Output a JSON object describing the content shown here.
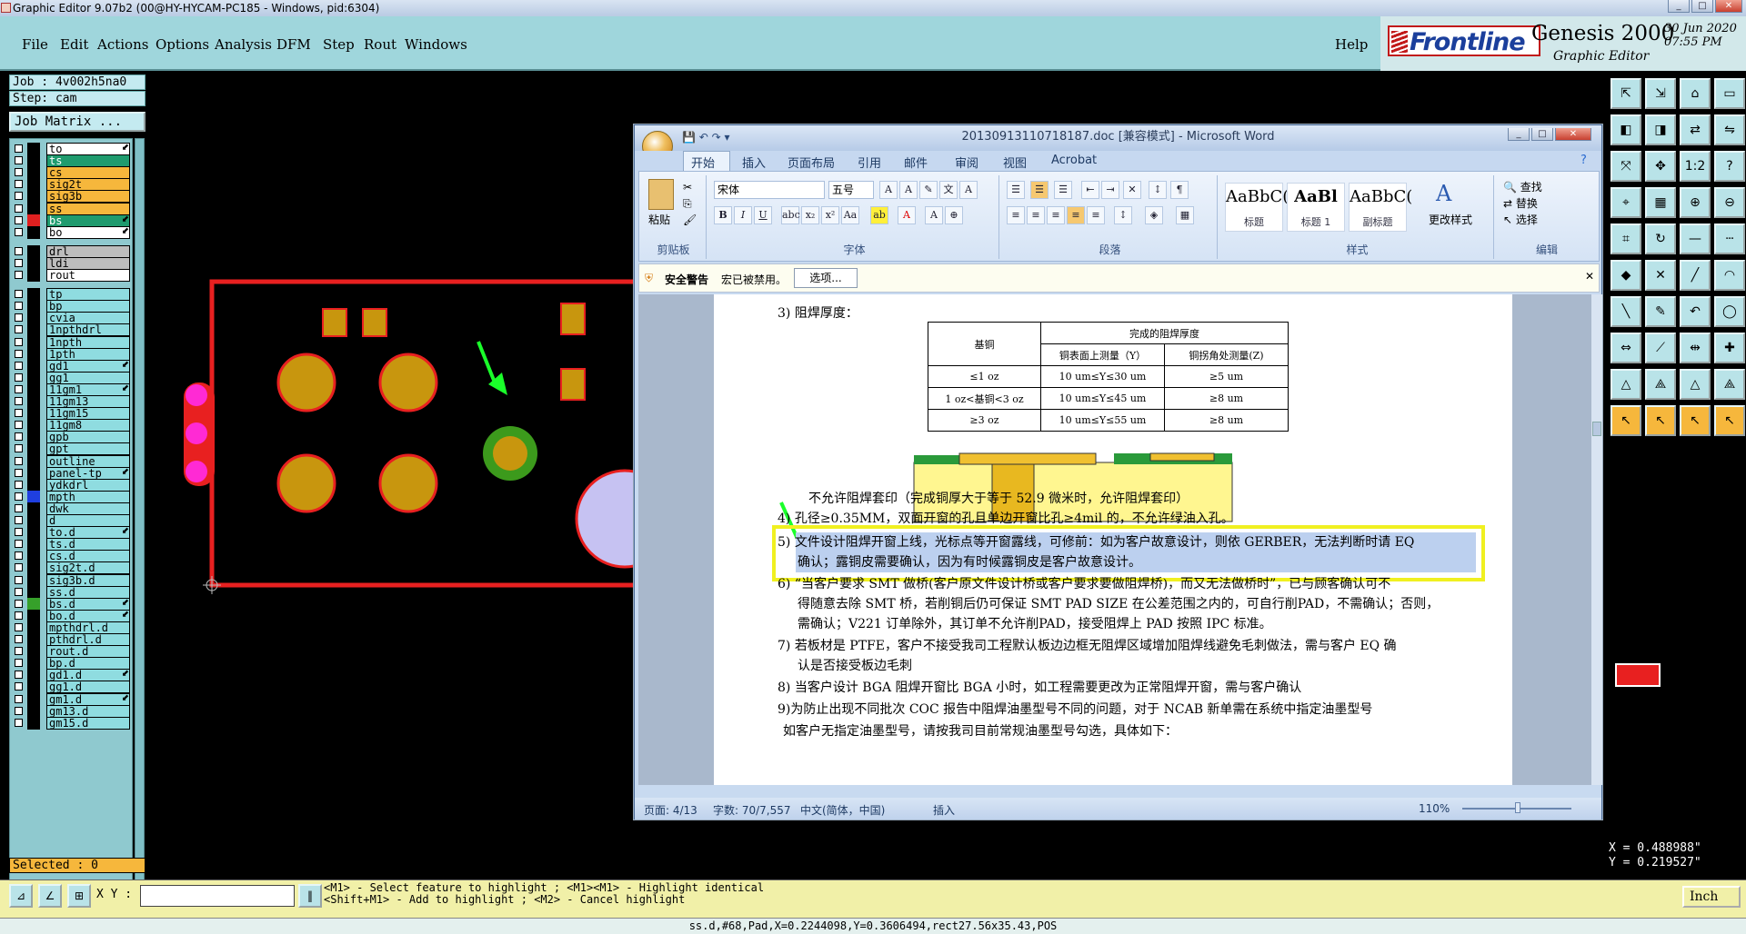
{
  "window_title": "Graphic Editor 9.07b2 (00@HY-HYCAM-PC185 - Windows, pid:6304)",
  "menu": [
    "File",
    "Edit",
    "Actions",
    "Options",
    "Analysis",
    "DFM",
    "Step",
    "Rout",
    "Windows"
  ],
  "help_label": "Help",
  "brand": {
    "logo": "Frontline",
    "name": "Genesis 2000",
    "subtitle": "Graphic Editor",
    "date": "30 Jun 2020",
    "time": "07:55 PM"
  },
  "job": "Job : 4v002h5na0",
  "step": "Step: cam",
  "job_matrix_label": "Job Matrix ...",
  "layers": [
    {
      "name": "to",
      "style": "white",
      "arrow": "⬋"
    },
    {
      "name": "ts",
      "style": "greenbar",
      "arrow": ""
    },
    {
      "name": "cs",
      "style": "orange",
      "arrow": ""
    },
    {
      "name": "sig2t",
      "style": "orange",
      "arrow": ""
    },
    {
      "name": "sig3b",
      "style": "orange",
      "arrow": ""
    },
    {
      "name": "ss",
      "style": "orange",
      "arrow": ""
    },
    {
      "name": "bs",
      "style": "greenbar",
      "arrow": "⬋",
      "swatch": "#e02020"
    },
    {
      "name": "bo",
      "style": "white",
      "arrow": "⬋"
    },
    {
      "name": "drl",
      "style": "grey",
      "arrow": ""
    },
    {
      "name": "ldi",
      "style": "grey",
      "arrow": ""
    },
    {
      "name": "rout",
      "style": "white",
      "arrow": ""
    },
    {
      "name": "tp",
      "style": "",
      "arrow": ""
    },
    {
      "name": "bp",
      "style": "",
      "arrow": ""
    },
    {
      "name": "cvia",
      "style": "",
      "arrow": ""
    },
    {
      "name": "1npthdrl",
      "style": "",
      "arrow": ""
    },
    {
      "name": "1npth",
      "style": "",
      "arrow": ""
    },
    {
      "name": "1pth",
      "style": "",
      "arrow": ""
    },
    {
      "name": "gd1",
      "style": "",
      "arrow": "⬋"
    },
    {
      "name": "gg1",
      "style": "",
      "arrow": ""
    },
    {
      "name": "11gm1",
      "style": "",
      "arrow": "⬋"
    },
    {
      "name": "11gm13",
      "style": "",
      "arrow": ""
    },
    {
      "name": "11gm15",
      "style": "",
      "arrow": ""
    },
    {
      "name": "11gm8",
      "style": "",
      "arrow": ""
    },
    {
      "name": "gpb",
      "style": "",
      "arrow": ""
    },
    {
      "name": "gpt",
      "style": "",
      "arrow": ""
    },
    {
      "name": "outline",
      "style": "",
      "arrow": ""
    },
    {
      "name": "panel-tp",
      "style": "",
      "arrow": "⬋"
    },
    {
      "name": "ydkdrl",
      "style": "",
      "arrow": ""
    },
    {
      "name": "mpth",
      "style": "",
      "arrow": "",
      "swatch": "#1f3fe0"
    },
    {
      "name": "dwk",
      "style": "",
      "arrow": ""
    },
    {
      "name": "d",
      "style": "",
      "arrow": ""
    },
    {
      "name": "to.d",
      "style": "",
      "arrow": "⬋"
    },
    {
      "name": "ts.d",
      "style": "",
      "arrow": ""
    },
    {
      "name": "cs.d",
      "style": "",
      "arrow": ""
    },
    {
      "name": "sig2t.d",
      "style": "",
      "arrow": ""
    },
    {
      "name": "sig3b.d",
      "style": "",
      "arrow": ""
    },
    {
      "name": "ss.d",
      "style": "",
      "arrow": ""
    },
    {
      "name": "bs.d",
      "style": "",
      "arrow": "⬋",
      "swatch": "#36a02a"
    },
    {
      "name": "bo.d",
      "style": "",
      "arrow": "⬋"
    },
    {
      "name": "mpthdrl.d",
      "style": "",
      "arrow": ""
    },
    {
      "name": "pthdrl.d",
      "style": "",
      "arrow": ""
    },
    {
      "name": "rout.d",
      "style": "",
      "arrow": ""
    },
    {
      "name": "bp.d",
      "style": "",
      "arrow": ""
    },
    {
      "name": "gd1.d",
      "style": "",
      "arrow": "⬋"
    },
    {
      "name": "gg1.d",
      "style": "",
      "arrow": ""
    },
    {
      "name": "gm1.d",
      "style": "",
      "arrow": "⬋"
    },
    {
      "name": "gm13.d",
      "style": "",
      "arrow": ""
    },
    {
      "name": "gm15.d",
      "style": "",
      "arrow": ""
    }
  ],
  "selected": "Selected : 0",
  "word": {
    "title": "20130913110718187.doc [兼容模式] - Microsoft Word",
    "tabs": [
      "开始",
      "插入",
      "页面布局",
      "引用",
      "邮件",
      "审阅",
      "视图",
      "Acrobat"
    ],
    "groups": [
      "剪贴板",
      "字体",
      "段落",
      "样式",
      "编辑"
    ],
    "paste_label": "粘贴",
    "font_name": "宋体",
    "font_size": "五号",
    "styles": [
      {
        "preview": "AaBbC(",
        "name": "标题"
      },
      {
        "preview": "AaBl",
        "name": "标题 1"
      },
      {
        "preview": "AaBbC(",
        "name": "副标题"
      }
    ],
    "change_styles": "更改样式",
    "edit_actions": [
      "查找",
      "替换",
      "选择"
    ],
    "security_title": "安全警告",
    "security_msg": "宏已被禁用。",
    "options_button": "选项...",
    "doc_lines": [
      "3)  阻焊厚度：",
      "不允许阻焊套印（完成铜厚大于等于 52.9 微米时，允许阻焊套印）",
      "4)  孔径≥0.35MM，双面开窗的孔且单边开窗比孔≥4mil 的，不允许绿油入孔。",
      "5)  文件设计阻焊开窗上线，光标点等开窗露线，可修前：如为客户故意设计，则依 GERBER，无法判断时请 EQ",
      "确认；露铜皮需要确认，因为有时候露铜皮是客户故意设计。",
      "6)  “当客户要求 SMT 做桥(客户原文件设计桥或客户要求要做阻焊桥)，而又无法做桥时”，已与顾客确认可不",
      "得随意去除 SMT 桥，若削铜后仍可保证 SMT PAD SIZE 在公差范围之内的，可自行削PAD，不需确认；否则，",
      "需确认；V221 订单除外，其订单不允许削PAD，接受阻焊上 PAD 按照 IPC 标准。",
      "7)  若板材是 PTFE，客户不接受我司工程默认板边边框无阻焊区域增加阻焊线避免毛刺做法，需与客户 EQ 确",
      "认是否接受板边毛刺",
      "8) 当客户设计 BGA 阻焊开窗比 BGA 小时，如工程需要更改为正常阻焊开窗，需与客户确认",
      "9)为防止出现不同批次 COC 报告中阻焊油墨型号不同的问题，对于 NCAB 新单需在系统中指定油墨型号",
      "如客户无指定油墨型号，请按我司目前常规油墨型号勾选，具体如下："
    ],
    "table_header": [
      "基铜",
      "完成的阻焊厚度",
      "铜表面上测量（Y）",
      "铜拐角处测量(Z)"
    ],
    "table_rows": [
      [
        "≤1 oz",
        "10 um≤Y≤30 um",
        "≥5 um"
      ],
      [
        "1 oz<基铜<3 oz",
        "10 um≤Y≤45 um",
        "≥8 um"
      ],
      [
        "≥3 oz",
        "10 um≤Y≤55 um",
        "≥8 um"
      ]
    ],
    "status": {
      "page": "页面: 4/13",
      "words": "字数: 70/7,557",
      "lang": "中文(简体，中国)",
      "mode": "插入",
      "zoom": "110%"
    }
  },
  "toolbar_icons": [
    "open",
    "save",
    "home",
    "panel",
    "left-arrow",
    "right-arrow",
    "swap",
    "flip",
    "fit",
    "move",
    "ratio-1-2",
    "help",
    "measure",
    "grid",
    "zoom-in",
    "zoom-out",
    "snap",
    "rotate",
    "cut",
    "dashed",
    "add-pad",
    "delete",
    "line",
    "arc",
    "line-red",
    "edit-line",
    "undo-arc",
    "contour",
    "resize",
    "select-line",
    "dim",
    "edit-pad",
    "triangle",
    "triangle-2",
    "triangle-3",
    "triangle-4",
    "pointer",
    "pointer-2",
    "pointer-3",
    "pointer-4"
  ],
  "coords": {
    "x": "X = 0.488988\"",
    "y": "Y = 0.219527\""
  },
  "xy_label": "X Y :",
  "prompt": "<M1> - Select feature to highlight ; <M1><M1> - Highlight identical\n<Shift+M1> - Add to highlight ; <M2> - Cancel highlight",
  "units": "Inch",
  "status_line": "ss.d,#68,Pad,X=0.2244098,Y=0.3606494,rect27.56x35.43,POS"
}
